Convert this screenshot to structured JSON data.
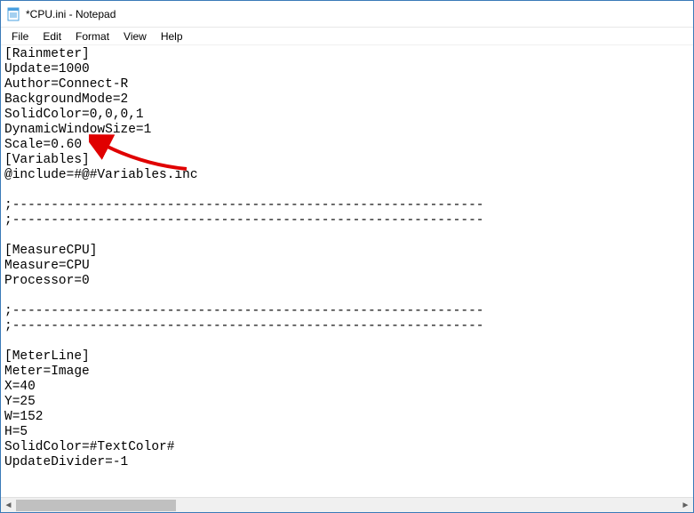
{
  "window": {
    "title": "*CPU.ini - Notepad"
  },
  "menu": {
    "file": "File",
    "edit": "Edit",
    "format": "Format",
    "view": "View",
    "help": "Help"
  },
  "editor": {
    "content": "[Rainmeter]\nUpdate=1000\nAuthor=Connect-R\nBackgroundMode=2\nSolidColor=0,0,0,1\nDynamicWindowSize=1\nScale=0.60\n[Variables]\n@include=#@#Variables.inc\n\n;-------------------------------------------------------------\n;-------------------------------------------------------------\n\n[MeasureCPU]\nMeasure=CPU\nProcessor=0\n\n;-------------------------------------------------------------\n;-------------------------------------------------------------\n\n[MeterLine]\nMeter=Image\nX=40\nY=25\nW=152\nH=5\nSolidColor=#TextColor#\nUpdateDivider=-1"
  },
  "annotation": {
    "arrow_color": "#e00000"
  }
}
